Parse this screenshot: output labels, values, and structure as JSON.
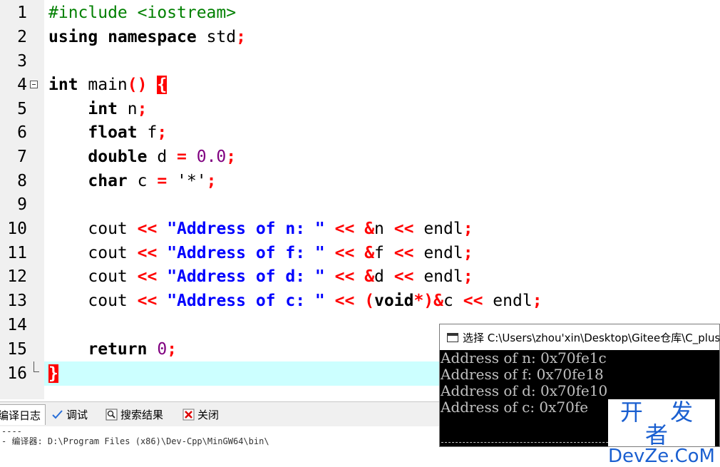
{
  "editor": {
    "lines": [
      {
        "n": "1"
      },
      {
        "n": "2"
      },
      {
        "n": "3"
      },
      {
        "n": "4"
      },
      {
        "n": "5"
      },
      {
        "n": "6"
      },
      {
        "n": "7"
      },
      {
        "n": "8"
      },
      {
        "n": "9"
      },
      {
        "n": "10"
      },
      {
        "n": "11"
      },
      {
        "n": "12"
      },
      {
        "n": "13"
      },
      {
        "n": "14"
      },
      {
        "n": "15"
      },
      {
        "n": "16"
      }
    ],
    "code": {
      "l1": "#include <iostream>",
      "l2_kw": "using namespace",
      "l2_id": " std",
      "l2_semi": ";",
      "l4_kw": "int",
      "l4_id": " main",
      "l4_paren": "()",
      "l4_brace": "{",
      "l5_kw": "int",
      "l5_id": " n",
      "semi": ";",
      "l6_kw": "float",
      "l6_id": " f",
      "l7_kw": "double",
      "l7_id": " d ",
      "eq": "=",
      "l7_num": " 0.0",
      "l8_kw": "char",
      "l8_id": " c ",
      "l8_chr": " '*'",
      "cout": "cout",
      "shl": "<<",
      "endl": "endl",
      "s_n": "\"Address of n: \"",
      "s_f": "\"Address of f: \"",
      "s_d": "\"Address of d: \"",
      "s_c": "\"Address of c: \"",
      "amp_n": "&",
      "v_n": "n",
      "amp_f": "&",
      "v_f": "f",
      "amp_d": "&",
      "v_d": "d",
      "lparen": "(",
      "void_kw": "void",
      "star": "*",
      "rparen": ")",
      "amp_c": "&",
      "v_c": "c",
      "ret_kw": "return",
      "ret_num": " 0",
      "close_brace": "}"
    }
  },
  "tabs": [
    {
      "label": "编译日志",
      "icon": "compile-log-icon"
    },
    {
      "label": "调试",
      "icon": "check-icon"
    },
    {
      "label": "搜索结果",
      "icon": "search-results-icon"
    },
    {
      "label": "关闭",
      "icon": "close-icon"
    }
  ],
  "log": {
    "line1": "----",
    "line2": "- 编译器: D:\\Program Files (x86)\\Dev-Cpp\\MinGW64\\bin\\"
  },
  "console": {
    "title": "选择 C:\\Users\\zhou'xin\\Desktop\\Gitee仓库\\C_plus_",
    "lines": [
      "Address of n: 0x70fe1c",
      "Address of f: 0x70fe18",
      "Address of d: 0x70fe10",
      "Address of c: 0x70fe"
    ]
  },
  "watermark": {
    "top": "开 发 者",
    "bottom": "DevZe.CoM"
  },
  "colors": {
    "keyword": "#000000",
    "preprocessor": "#008000",
    "operator": "#ff0000",
    "string": "#0000ff",
    "number": "#800080",
    "current_line": "#ccffff",
    "watermark": "#1a5fd0"
  }
}
